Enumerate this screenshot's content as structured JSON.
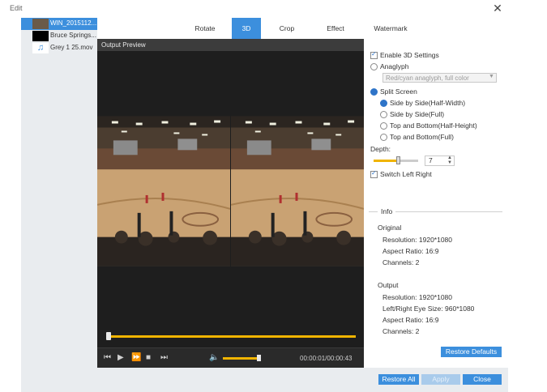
{
  "window": {
    "title": "Edit",
    "close_icon": "close-icon"
  },
  "sidebar": {
    "items": [
      {
        "label": "WIN_2015112...",
        "selected": true,
        "thumb": "video-thumb"
      },
      {
        "label": "Bruce Springs...",
        "selected": false,
        "thumb": "video-thumb-black"
      },
      {
        "label": "Grey 1 25.mov",
        "selected": false,
        "thumb": "music-note-icon"
      }
    ]
  },
  "tabs": [
    {
      "label": "Rotate",
      "active": false
    },
    {
      "label": "3D",
      "active": true
    },
    {
      "label": "Crop",
      "active": false
    },
    {
      "label": "Effect",
      "active": false
    },
    {
      "label": "Watermark",
      "active": false
    }
  ],
  "preview": {
    "title": "Output Preview",
    "time": "00:00:01/00:00:43",
    "seek_progress": 0.0,
    "volume": 1.0
  },
  "settings": {
    "enable_3d": {
      "label": "Enable 3D Settings",
      "checked": true
    },
    "anaglyph": {
      "label": "Anaglyph",
      "checked": false
    },
    "anaglyph_select": {
      "value": "Red/cyan anaglyph, full color",
      "disabled": true
    },
    "split_screen": {
      "label": "Split Screen",
      "checked": true
    },
    "split_options": [
      {
        "label": "Side by Side(Half-Width)",
        "checked": true
      },
      {
        "label": "Side by Side(Full)",
        "checked": false
      },
      {
        "label": "Top and Bottom(Half-Height)",
        "checked": false
      },
      {
        "label": "Top and Bottom(Full)",
        "checked": false
      }
    ],
    "depth": {
      "label": "Depth:",
      "value": "7"
    },
    "switch_lr": {
      "label": "Switch Left Right",
      "checked": true
    }
  },
  "info": {
    "legend": "Info",
    "original": {
      "heading": "Original",
      "resolution": "Resolution: 1920*1080",
      "aspect": "Aspect Ratio: 16:9",
      "channels": "Channels: 2"
    },
    "output": {
      "heading": "Output",
      "resolution": "Resolution: 1920*1080",
      "eye_size": "Left/Right Eye Size: 960*1080",
      "aspect": "Aspect Ratio: 16:9",
      "channels": "Channels: 2"
    }
  },
  "buttons": {
    "restore_defaults": "Restore Defaults",
    "restore_all": "Restore All",
    "apply": "Apply",
    "close": "Close"
  },
  "colors": {
    "accent": "#3c8fdd",
    "slider": "#f0b400",
    "sidebar_selected": "#3c8fdd"
  }
}
